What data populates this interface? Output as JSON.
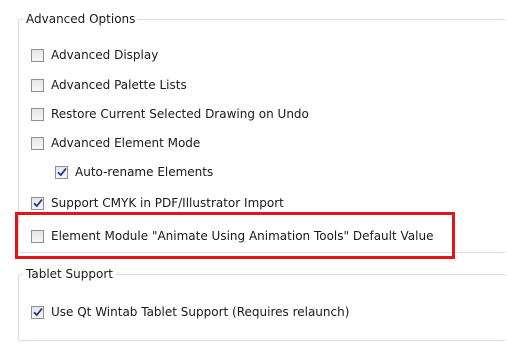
{
  "advanced_options": {
    "title": "Advanced Options",
    "items": [
      {
        "label": "Advanced Display",
        "checked": false
      },
      {
        "label": "Advanced Palette Lists",
        "checked": false
      },
      {
        "label": "Restore Current Selected Drawing on Undo",
        "checked": false
      },
      {
        "label": "Advanced Element Mode",
        "checked": false
      },
      {
        "label": "Auto-rename Elements",
        "checked": true
      },
      {
        "label": "Support CMYK in PDF/Illustrator Import",
        "checked": true
      },
      {
        "label": "Element Module \"Animate Using Animation Tools\" Default Value",
        "checked": false
      }
    ]
  },
  "tablet_support": {
    "title": "Tablet Support",
    "items": [
      {
        "label": "Use Qt Wintab Tablet Support (Requires relaunch)",
        "checked": true
      }
    ]
  },
  "colors": {
    "highlight": "#e3141c",
    "checkmark": "#1f3a8a",
    "group_border": "#d5dde5"
  },
  "icons": {
    "checkmark": "checkmark-icon"
  }
}
